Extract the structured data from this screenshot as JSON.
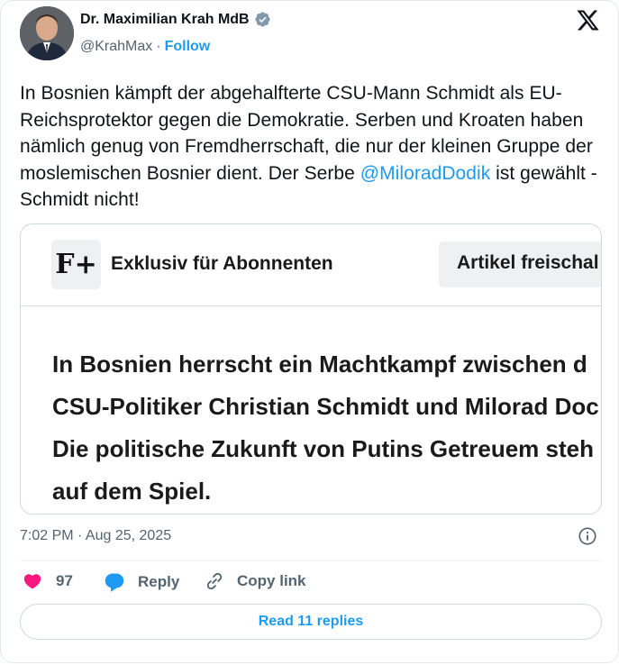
{
  "author": {
    "display_name": "Dr. Maximilian Krah MdB",
    "handle": "@KrahMax",
    "separator": "·",
    "follow_label": "Follow",
    "verified_color": "#829aab"
  },
  "tweet": {
    "text_before_mention": "In Bosnien kämpft der abgehalfterte CSU-Mann Schmidt als EU-Reichsprotektor gegen die Demokratie. Serben und Kroaten haben nämlich genug von Fremdherrschaft, die nur der kleinen Gruppe der moslemischen Bosnier dient. Der Serbe ",
    "mention": "@MiloradDodik",
    "text_after_mention": " ist gewählt - Schmidt nicht!"
  },
  "embed": {
    "logo_text": "F+",
    "exclusive_label": "Exklusiv für Abonnenten",
    "unlock_label": "Artikel freischal",
    "body_lines": [
      "In Bosnien herrscht ein Machtkampf zwischen d",
      "CSU-Politiker Christian Schmidt und Milorad Doc",
      "Die politische Zukunft von Putins Getreuem steh",
      "auf dem Spiel."
    ]
  },
  "meta": {
    "timestamp": "7:02 PM · Aug 25, 2025"
  },
  "actions": {
    "like_count": "97",
    "reply_label": "Reply",
    "copy_link_label": "Copy link",
    "read_replies_label": "Read 11 replies"
  },
  "colors": {
    "accent": "#1d9bf0",
    "like": "#f91880",
    "muted": "#536471"
  }
}
